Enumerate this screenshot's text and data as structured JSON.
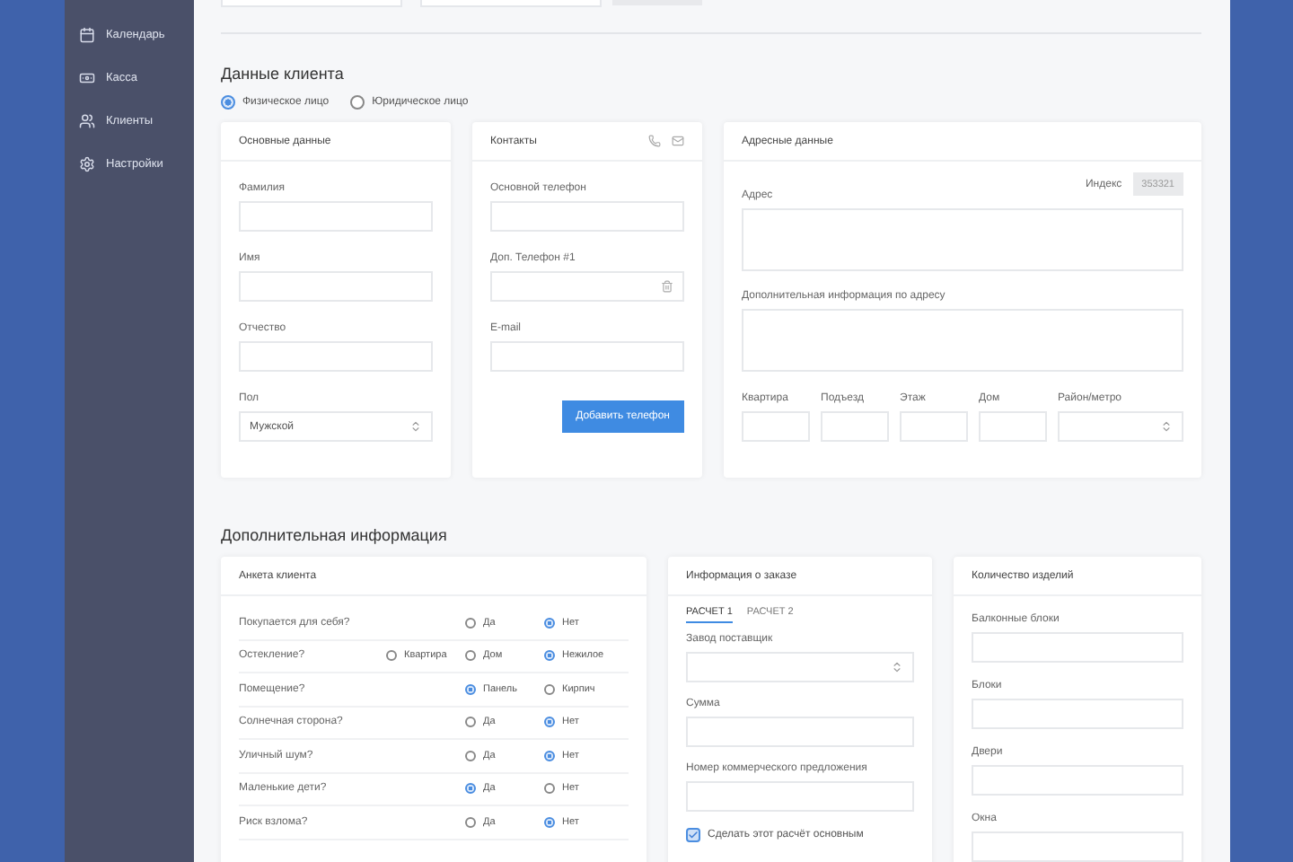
{
  "sidebar": {
    "items": [
      {
        "label": "Календарь",
        "selected": false
      },
      {
        "label": "Касса",
        "selected": false
      },
      {
        "label": "Клиенты",
        "selected": false
      },
      {
        "label": "Настройки",
        "selected": false
      }
    ]
  },
  "client": {
    "title": "Данные клиента",
    "person_types": [
      {
        "label": "Физическое лицо",
        "selected": true
      },
      {
        "label": "Юридическое лицо",
        "selected": false
      }
    ],
    "main": {
      "title": "Основные данные",
      "fields": [
        {
          "label": "Фамилия"
        },
        {
          "label": "Имя"
        },
        {
          "label": "Отчество"
        },
        {
          "label": "Пол",
          "kind": "select",
          "value": "Мужской"
        }
      ]
    },
    "contacts": {
      "title": "Контакты",
      "fields": [
        {
          "label": "Основной телефон"
        },
        {
          "label": "Доп. Телефон #1",
          "kind": "removable"
        },
        {
          "label": "E-mail"
        }
      ],
      "button": "Добавить телефон"
    },
    "address": {
      "title": "Адресные данные",
      "index_label": "Индекс",
      "index_value": "353321",
      "address_label": "Адрес",
      "extra_label": "Дополнительная информация по адресу",
      "small_fields": [
        {
          "label": "Квартира"
        },
        {
          "label": "Подъезд"
        },
        {
          "label": "Этаж"
        },
        {
          "label": "Дом"
        },
        {
          "label": "Район/метро",
          "kind": "select"
        }
      ]
    }
  },
  "extra": {
    "title": "Дополнительная информация",
    "survey": {
      "title": "Анкета клиента",
      "rows": [
        {
          "question": "Покупается для себя?",
          "options": [
            {
              "label": "Да",
              "selected": false
            },
            {
              "label": "Нет",
              "selected": true
            }
          ]
        },
        {
          "question": "Остеклениe?",
          "options": [
            {
              "label": "Квартира",
              "selected": false
            },
            {
              "label": "Дом",
              "selected": false
            },
            {
              "label": "Нежилое",
              "selected": true
            }
          ]
        },
        {
          "question": "Помещение?",
          "options": [
            {
              "label": "Панель",
              "selected": true
            },
            {
              "label": "Кирпич",
              "selected": false
            }
          ]
        },
        {
          "question": "Солнечная сторона?",
          "options": [
            {
              "label": "Да",
              "selected": false
            },
            {
              "label": "Нет",
              "selected": true
            }
          ]
        },
        {
          "question": "Уличный шум?",
          "options": [
            {
              "label": "Да",
              "selected": false
            },
            {
              "label": "Нет",
              "selected": true
            }
          ]
        },
        {
          "question": "Маленькие дети?",
          "options": [
            {
              "label": "Да",
              "selected": true
            },
            {
              "label": "Нет",
              "selected": false
            }
          ]
        },
        {
          "question": "Риск взлома?",
          "options": [
            {
              "label": "Да",
              "selected": false
            },
            {
              "label": "Нет",
              "selected": true
            }
          ]
        }
      ]
    },
    "order": {
      "title": "Информация о заказе",
      "tabs": [
        {
          "label": "РАСЧЕТ 1",
          "selected": true
        },
        {
          "label": "РАСЧЕТ 2",
          "selected": false
        }
      ],
      "fields": [
        {
          "label": "Завод поставщик",
          "kind": "select"
        },
        {
          "label": "Сумма"
        },
        {
          "label": "Номер коммерческого предложения"
        }
      ],
      "main_checkbox": {
        "label": "Сделать этот расчёт основным",
        "checked": true
      }
    },
    "products": {
      "title": "Количество изделий",
      "fields": [
        {
          "label": "Балконные блоки"
        },
        {
          "label": "Блоки"
        },
        {
          "label": "Двери"
        },
        {
          "label": "Окна"
        }
      ]
    }
  }
}
